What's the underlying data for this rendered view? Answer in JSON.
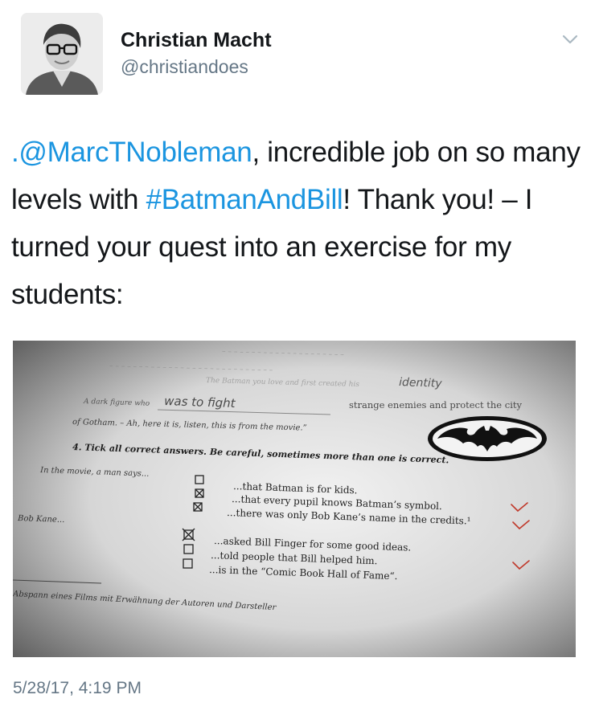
{
  "author": {
    "name": "Christian Macht",
    "handle": "@christiandoes"
  },
  "tweet": {
    "mention": ".@MarcTNobleman",
    "text_1": ", incredible job on so many levels with ",
    "hashtag": "#BatmanAndBill",
    "text_2": "! Thank you! – I turned your quest into an exercise for my students:"
  },
  "timestamp": "5/28/17, 4:19 PM",
  "worksheet": {
    "faded_line": "The Batman you love and first created his",
    "handwritten_1": "identity",
    "line_prefix": "A dark figure who",
    "handwritten_2": "was to fight",
    "line_suffix": "strange enemies and protect the city",
    "gotham_line": "of Gotham. – Ah, here it is, listen, this is from the movie.”",
    "task_heading": "4. Tick all correct answers. Be careful, sometimes more than one is correct.",
    "movie_label": "In the movie, a man says...",
    "options_a": [
      {
        "text": "...that Batman is for kids.",
        "checked": false,
        "correct": false
      },
      {
        "text": "...that every pupil knows Batman’s symbol.",
        "checked": true,
        "correct": true
      },
      {
        "text": "...there was only Bob Kane’s name in the credits.¹",
        "checked": true,
        "correct": true
      }
    ],
    "bob_label": "Bob Kane...",
    "options_b": [
      {
        "text": "...asked Bill Finger for some good ideas.",
        "checked": true,
        "correct": true
      },
      {
        "text": "...told people that Bill helped him.",
        "checked": false,
        "correct": false
      },
      {
        "text": "...is in the “Comic Book Hall of Fame“.",
        "checked": false,
        "correct": true
      }
    ],
    "footnote": "Abspann eines Films mit Erwähnung der Autoren und Darsteller"
  },
  "icons": {
    "menu": "chevron-down-icon",
    "logo": "bat-symbol-icon"
  },
  "colors": {
    "link": "#1b95e0",
    "secondary_text": "#657786",
    "correction_mark": "#c0392b"
  }
}
